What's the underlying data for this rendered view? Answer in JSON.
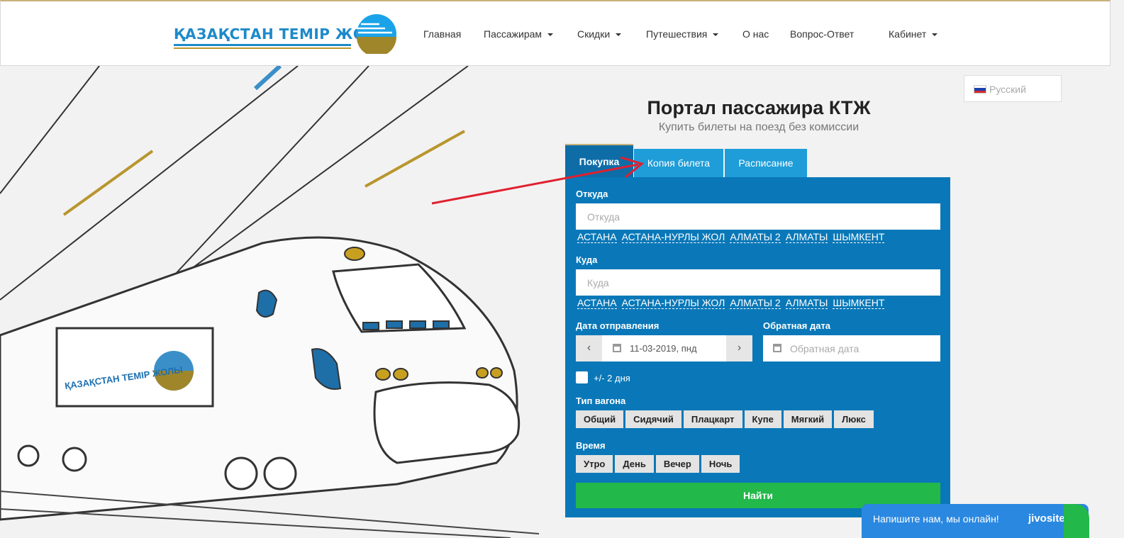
{
  "header": {
    "logo_text": "ҚАЗАҚСТАН ТЕМІР ЖОЛЫ",
    "nav": [
      {
        "label": "Главная",
        "dropdown": false
      },
      {
        "label": "Пассажирам",
        "dropdown": true
      },
      {
        "label": "Скидки",
        "dropdown": true
      },
      {
        "label": "Путешествия",
        "dropdown": true
      },
      {
        "label": "О нас",
        "dropdown": false
      },
      {
        "label": "Вопрос-Ответ",
        "dropdown": false
      },
      {
        "label": "Кабинет",
        "dropdown": true
      }
    ]
  },
  "lang": {
    "selected": "Русский"
  },
  "hero": {
    "title": "Портал пассажира КТЖ",
    "subtitle": "Купить билеты на поезд без комиссии",
    "train_logo_text": "ҚАЗАҚСТАН ТЕМІР ЖОЛЫ"
  },
  "tabs": [
    "Покупка",
    "Копия билета",
    "Расписание"
  ],
  "form": {
    "from": {
      "label": "Откуда",
      "placeholder": "Откуда",
      "quick": [
        "АСТАНА",
        "АСТАНА-НУРЛЫ ЖОЛ",
        "АЛМАТЫ 2",
        "АЛМАТЫ",
        "ШЫМКЕНТ"
      ]
    },
    "to": {
      "label": "Куда",
      "placeholder": "Куда",
      "quick": [
        "АСТАНА",
        "АСТАНА-НУРЛЫ ЖОЛ",
        "АЛМАТЫ 2",
        "АЛМАТЫ",
        "ШЫМКЕНТ"
      ]
    },
    "depart": {
      "label": "Дата отправления",
      "value": "11-03-2019, пнд"
    },
    "return": {
      "label": "Обратная дата",
      "placeholder": "Обратная дата"
    },
    "flex": {
      "label": "+/- 2 дня",
      "checked": false
    },
    "car_type": {
      "label": "Тип вагона",
      "options": [
        "Общий",
        "Сидячий",
        "Плацкарт",
        "Купе",
        "Мягкий",
        "Люкс"
      ]
    },
    "time": {
      "label": "Время",
      "options": [
        "Утро",
        "День",
        "Вечер",
        "Ночь"
      ]
    },
    "submit": "Найти"
  },
  "chat": {
    "text": "Напишите нам, мы онлайн!",
    "brand": "jivosite"
  },
  "colors": {
    "primary": "#0a78b8",
    "tab": "#1e9dd8",
    "green": "#22b84a",
    "gold": "#c8b27a",
    "annotation_arrow": "#e02030"
  },
  "icons": [
    "calendar-icon",
    "chevron-left-icon",
    "chevron-right-icon",
    "caret-down-icon",
    "flag-ru-icon"
  ]
}
